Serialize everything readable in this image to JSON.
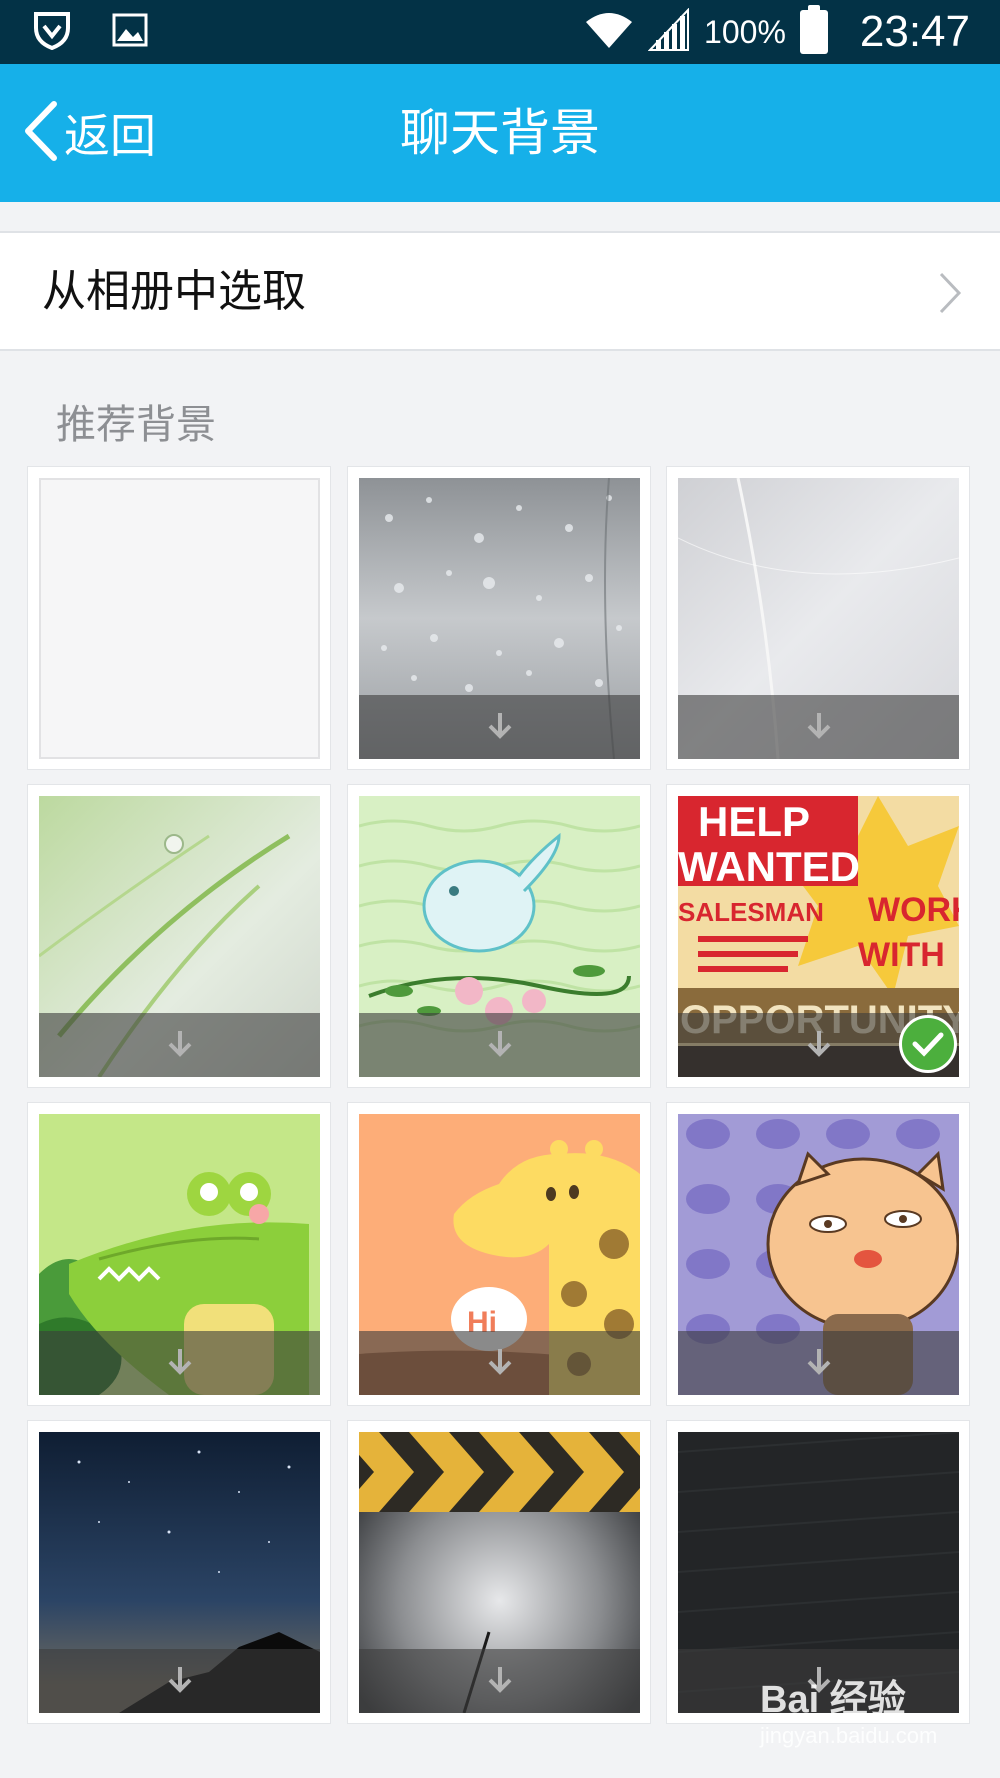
{
  "status_bar": {
    "battery": "100%",
    "time": "23:47",
    "icons": [
      "shield-icon",
      "image-icon",
      "wifi-icon",
      "signal-icon",
      "battery-icon"
    ]
  },
  "header": {
    "back_label": "返回",
    "title": "聊天背景",
    "color": "#16b0e9"
  },
  "album": {
    "label": "从相册中选取"
  },
  "section": {
    "label": "推荐背景"
  },
  "backgrounds": [
    {
      "name": "blank-white",
      "download": false,
      "selected": false
    },
    {
      "name": "raindrops-on-glass",
      "download": true,
      "selected": false
    },
    {
      "name": "white-feather",
      "download": true,
      "selected": false
    },
    {
      "name": "green-grass-dewdrop",
      "download": true,
      "selected": false
    },
    {
      "name": "bird-on-flowers",
      "download": true,
      "selected": false
    },
    {
      "name": "help-wanted-poster",
      "download": true,
      "selected": true,
      "texts": [
        "HELP",
        "WANTED",
        "SALESMAN",
        "WORK",
        "WITH",
        "OPPORTUNITY"
      ]
    },
    {
      "name": "green-crocodile",
      "download": true,
      "selected": false
    },
    {
      "name": "giraffe",
      "download": true,
      "selected": false,
      "texts": [
        "Hi"
      ]
    },
    {
      "name": "cartoon-cat",
      "download": true,
      "selected": false
    },
    {
      "name": "starry-night-sky",
      "download": true,
      "selected": false
    },
    {
      "name": "chevron-arrows-metal",
      "download": true,
      "selected": false
    },
    {
      "name": "dark-fabric",
      "download": true,
      "selected": false
    }
  ],
  "watermark": {
    "logo": "Bai 经验",
    "url": "jingyan.baidu.com"
  }
}
